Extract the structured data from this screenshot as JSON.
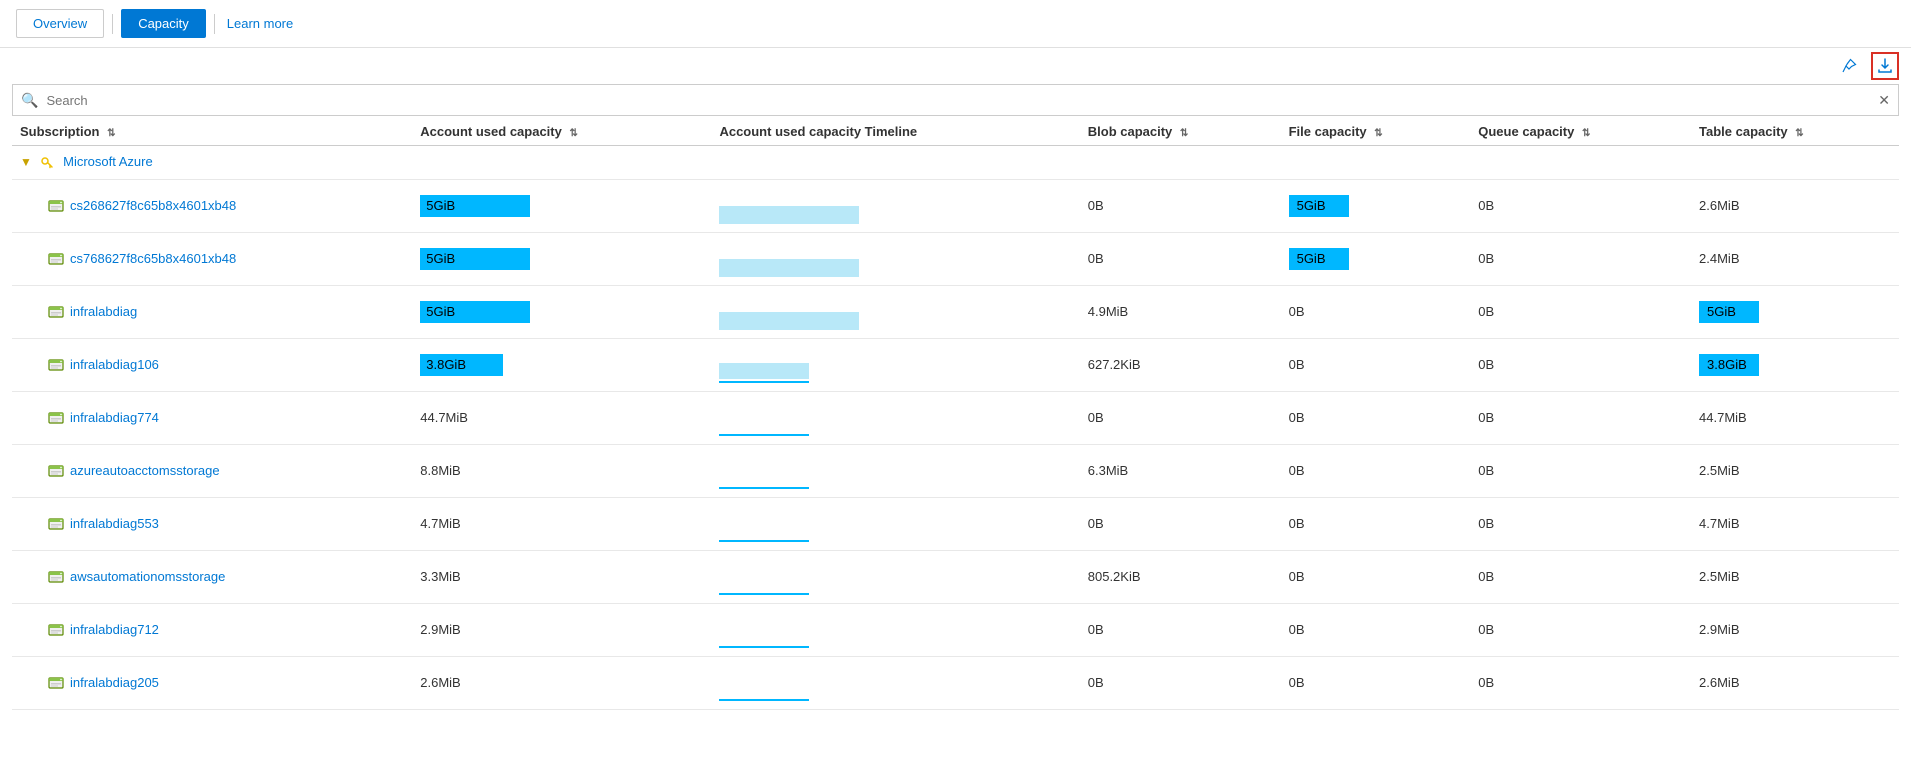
{
  "nav": {
    "overview_label": "Overview",
    "capacity_label": "Capacity",
    "learn_more_label": "Learn more"
  },
  "toolbar": {
    "pin_icon": "📌",
    "download_icon": "⬇"
  },
  "search": {
    "placeholder": "Search"
  },
  "table": {
    "columns": [
      {
        "key": "subscription",
        "label": "Subscription"
      },
      {
        "key": "account_used_capacity",
        "label": "Account used capacity"
      },
      {
        "key": "account_used_capacity_timeline",
        "label": "Account used capacity Timeline"
      },
      {
        "key": "blob_capacity",
        "label": "Blob capacity"
      },
      {
        "key": "file_capacity",
        "label": "File capacity"
      },
      {
        "key": "queue_capacity",
        "label": "Queue capacity"
      },
      {
        "key": "table_capacity",
        "label": "Table capacity"
      }
    ],
    "group": {
      "name": "Microsoft Azure",
      "icon": "key"
    },
    "rows": [
      {
        "name": "cs268627f8c65b8x4601xb48",
        "used_capacity": "5GiB",
        "used_capacity_bar": "full",
        "blob_capacity": "0B",
        "file_capacity": "5GiB",
        "file_highlight": true,
        "queue_capacity": "0B",
        "table_capacity": "2.6MiB",
        "table_highlight": false
      },
      {
        "name": "cs768627f8c65b8x4601xb48",
        "used_capacity": "5GiB",
        "used_capacity_bar": "full",
        "blob_capacity": "0B",
        "file_capacity": "5GiB",
        "file_highlight": true,
        "queue_capacity": "0B",
        "table_capacity": "2.4MiB",
        "table_highlight": false
      },
      {
        "name": "infralabdiag",
        "used_capacity": "5GiB",
        "used_capacity_bar": "full",
        "blob_capacity": "4.9MiB",
        "file_capacity": "0B",
        "file_highlight": false,
        "queue_capacity": "0B",
        "table_capacity": "5GiB",
        "table_highlight": true
      },
      {
        "name": "infralabdiag106",
        "used_capacity": "3.8GiB",
        "used_capacity_bar": "partial",
        "blob_capacity": "627.2KiB",
        "file_capacity": "0B",
        "file_highlight": false,
        "queue_capacity": "0B",
        "table_capacity": "3.8GiB",
        "table_highlight": true
      },
      {
        "name": "infralabdiag774",
        "used_capacity": "44.7MiB",
        "used_capacity_bar": "none",
        "blob_capacity": "0B",
        "file_capacity": "0B",
        "file_highlight": false,
        "queue_capacity": "0B",
        "table_capacity": "44.7MiB",
        "table_highlight": false
      },
      {
        "name": "azureautoacctomsstorage",
        "used_capacity": "8.8MiB",
        "used_capacity_bar": "none",
        "blob_capacity": "6.3MiB",
        "file_capacity": "0B",
        "file_highlight": false,
        "queue_capacity": "0B",
        "table_capacity": "2.5MiB",
        "table_highlight": false
      },
      {
        "name": "infralabdiag553",
        "used_capacity": "4.7MiB",
        "used_capacity_bar": "none",
        "blob_capacity": "0B",
        "file_capacity": "0B",
        "file_highlight": false,
        "queue_capacity": "0B",
        "table_capacity": "4.7MiB",
        "table_highlight": false
      },
      {
        "name": "awsautomationomsstorage",
        "used_capacity": "3.3MiB",
        "used_capacity_bar": "none",
        "blob_capacity": "805.2KiB",
        "file_capacity": "0B",
        "file_highlight": false,
        "queue_capacity": "0B",
        "table_capacity": "2.5MiB",
        "table_highlight": false
      },
      {
        "name": "infralabdiag712",
        "used_capacity": "2.9MiB",
        "used_capacity_bar": "none",
        "blob_capacity": "0B",
        "file_capacity": "0B",
        "file_highlight": false,
        "queue_capacity": "0B",
        "table_capacity": "2.9MiB",
        "table_highlight": false
      },
      {
        "name": "infralabdiag205",
        "used_capacity": "2.6MiB",
        "used_capacity_bar": "none",
        "blob_capacity": "0B",
        "file_capacity": "0B",
        "file_highlight": false,
        "queue_capacity": "0B",
        "table_capacity": "2.6MiB",
        "table_highlight": false
      }
    ]
  }
}
